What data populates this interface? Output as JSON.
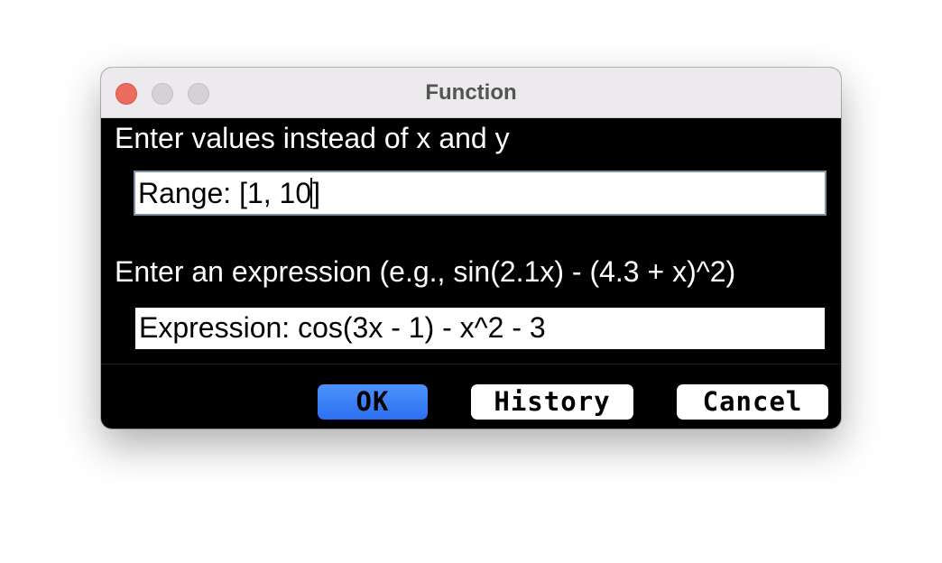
{
  "window": {
    "title": "Function"
  },
  "range": {
    "prompt": "Enter values instead of x and y",
    "value": "Range: [1, 10",
    "value_after_caret": "]"
  },
  "expression": {
    "prompt": "Enter an expression (e.g., sin(2.1x) - (4.3 + x)^2)",
    "value": "Expression: cos(3x - 1) - x^2 - 3"
  },
  "buttons": {
    "ok": "OK",
    "history": "History",
    "cancel": "Cancel"
  },
  "colors": {
    "dialog_background": "#000000",
    "default_button": "#3b80f7",
    "close_button": "#ec6a5e"
  }
}
